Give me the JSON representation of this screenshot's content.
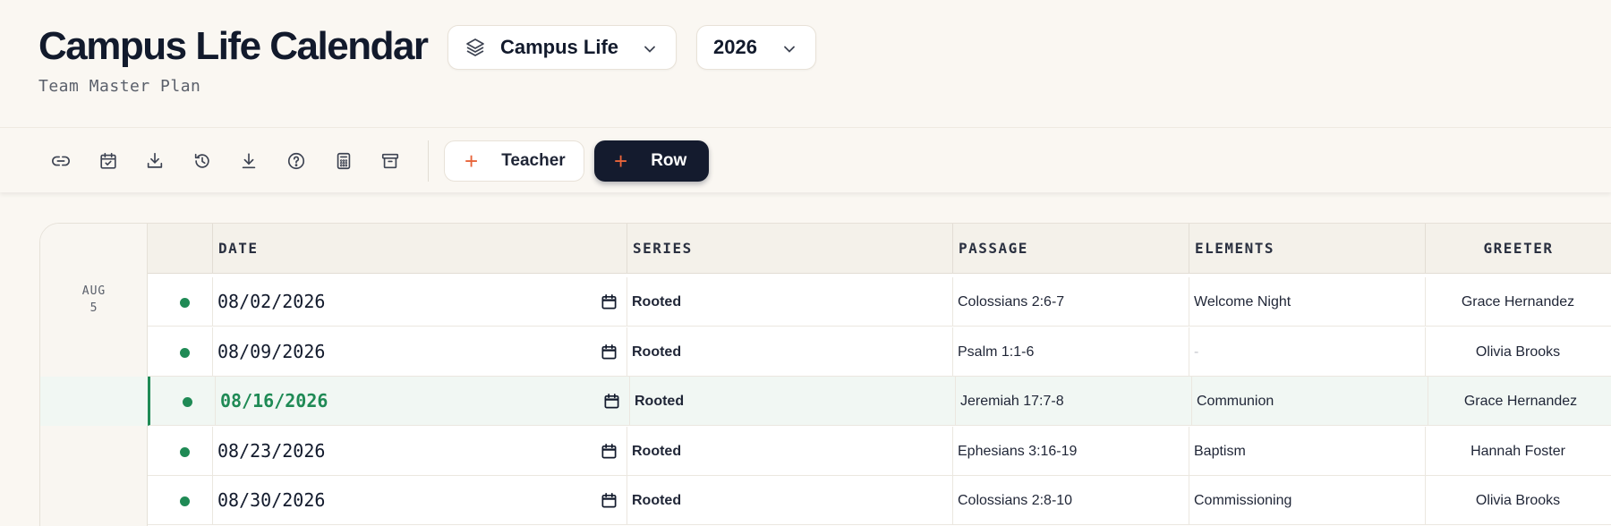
{
  "header": {
    "title": "Campus Life Calendar",
    "subtitle": "Team Master Plan",
    "workspace": "Campus Life",
    "year": "2026"
  },
  "toolbar": {
    "icons": [
      "link-icon",
      "calendar-check-icon",
      "download-tray-icon",
      "history-icon",
      "download-icon",
      "help-icon",
      "calculator-icon",
      "archive-icon"
    ],
    "teacher_label": "Teacher",
    "row_label": "Row"
  },
  "table": {
    "columns": [
      "DATE",
      "SERIES",
      "PASSAGE",
      "ELEMENTS",
      "GREETER"
    ],
    "group": {
      "month": "AUG",
      "count": "5"
    },
    "rows": [
      {
        "date": "08/02/2026",
        "series": "Rooted",
        "passage": "Colossians 2:6-7",
        "elements": "Welcome Night",
        "greeter": "Grace Hernandez"
      },
      {
        "date": "08/09/2026",
        "series": "Rooted",
        "passage": "Psalm 1:1-6",
        "elements": "-",
        "greeter": "Olivia Brooks"
      },
      {
        "date": "08/16/2026",
        "series": "Rooted",
        "passage": "Jeremiah 17:7-8",
        "elements": "Communion",
        "greeter": "Grace Hernandez"
      },
      {
        "date": "08/23/2026",
        "series": "Rooted",
        "passage": "Ephesians 3:16-19",
        "elements": "Baptism",
        "greeter": "Hannah Foster"
      },
      {
        "date": "08/30/2026",
        "series": "Rooted",
        "passage": "Colossians 2:8-10",
        "elements": "Commissioning",
        "greeter": "Olivia Brooks"
      }
    ]
  },
  "colors": {
    "accent_green": "#1f8a55",
    "accent_orange": "#e8643a",
    "navy": "#141b2e"
  }
}
